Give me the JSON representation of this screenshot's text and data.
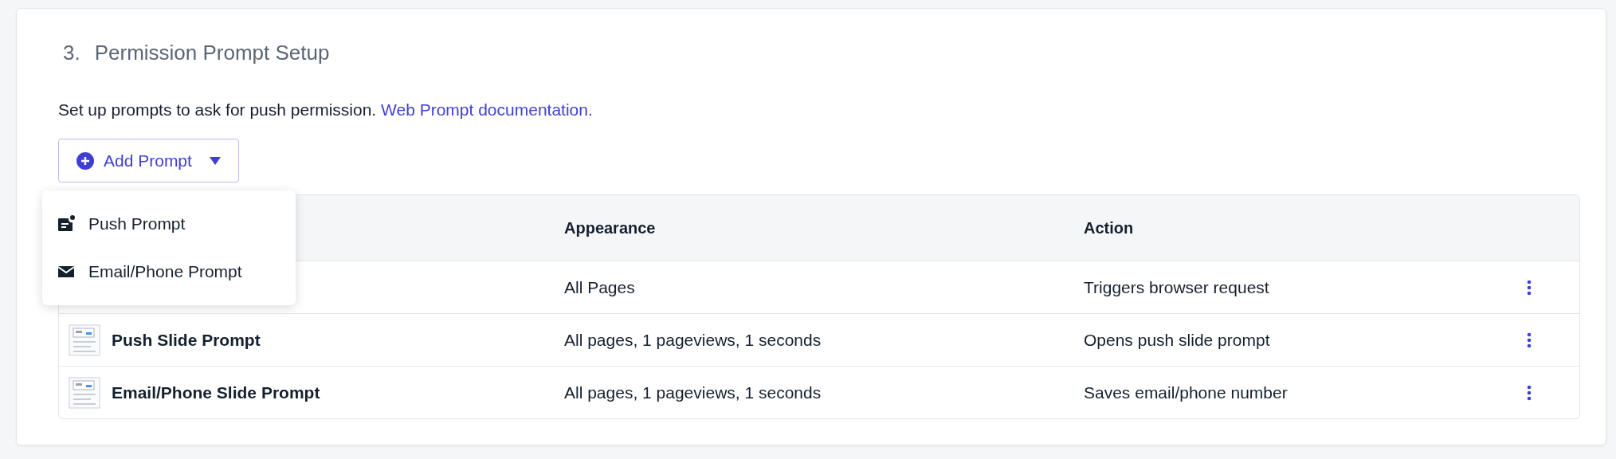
{
  "section": {
    "number": "3.",
    "title": "Permission Prompt Setup",
    "description": "Set up prompts to ask for push permission.",
    "doc_link": "Web Prompt documentation."
  },
  "add_button": {
    "label": "Add Prompt",
    "expanded": true
  },
  "menu": [
    {
      "label": "Push Prompt",
      "kind": "push"
    },
    {
      "label": "Email/Phone Prompt",
      "kind": "email"
    }
  ],
  "table": {
    "columns": [
      "Appearance",
      "Action"
    ],
    "rows": [
      {
        "kind": "native",
        "appearance": "All Pages",
        "action": "Triggers browser request"
      },
      {
        "kind": "slide",
        "name": "Push Slide Prompt",
        "appearance": "All pages, 1 pageviews, 1 seconds",
        "action": "Opens push slide prompt"
      },
      {
        "kind": "slide",
        "name": "Email/Phone Slide Prompt",
        "appearance": "All pages, 1 pageviews, 1 seconds",
        "action": "Saves email/phone number"
      }
    ]
  }
}
